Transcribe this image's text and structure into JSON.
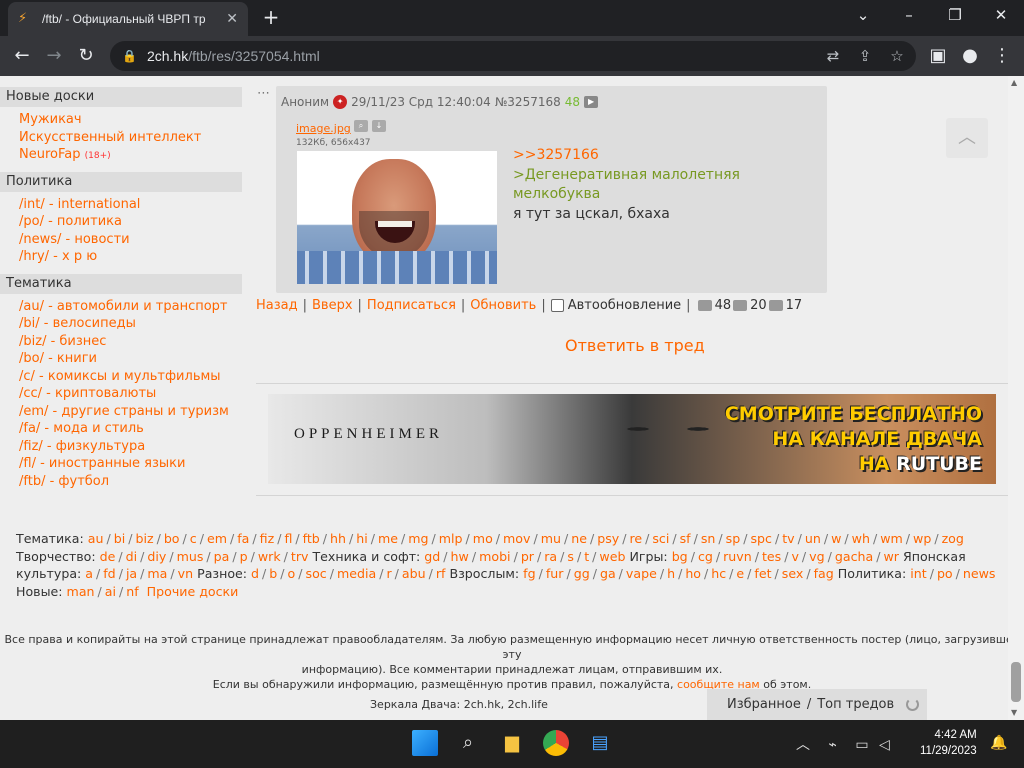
{
  "browser": {
    "tab_title": "/ftb/ - Официальный ЧВРП тр",
    "url_domain": "2ch.hk",
    "url_path": "/ftb/res/3257054.html"
  },
  "sidebar": {
    "sections": [
      {
        "title": "Новые доски",
        "items": [
          {
            "label": "Мужикач"
          },
          {
            "label": "Искусственный интеллект"
          },
          {
            "label": "NeuroFap",
            "badge": "(18+)"
          }
        ]
      },
      {
        "title": "Политика",
        "items": [
          {
            "label": "/int/ - international"
          },
          {
            "label": "/po/ - политика"
          },
          {
            "label": "/news/ - новости"
          },
          {
            "label": "/hry/ - х р ю"
          }
        ]
      },
      {
        "title": "Тематика",
        "items": [
          {
            "label": "/au/ - автомобили и транспорт"
          },
          {
            "label": "/bi/ - велосипеды"
          },
          {
            "label": "/biz/ - бизнес"
          },
          {
            "label": "/bo/ - книги"
          },
          {
            "label": "/c/ - комиксы и мультфильмы"
          },
          {
            "label": "/cc/ - криптовалюты"
          },
          {
            "label": "/em/ - другие страны и туризм"
          },
          {
            "label": "/fa/ - мода и стиль"
          },
          {
            "label": "/fiz/ - физкультура"
          },
          {
            "label": "/fl/ - иностранные языки"
          },
          {
            "label": "/ftb/ - футбол"
          }
        ]
      }
    ]
  },
  "post": {
    "author": "Аноним",
    "datetime": "29/11/23 Срд 12:40:04",
    "number": "№3257168",
    "replies": "48",
    "file_name": "image.jpg",
    "file_info": "132Кб, 656x437",
    "reflink": ">>3257166",
    "quote": ">Дегенеративная малолетняя мелкобуква",
    "text": "я тут за цскал, бхаха"
  },
  "thread_nav": {
    "back": "Назад",
    "top": "Вверх",
    "subscribe": "Подписаться",
    "refresh": "Обновить",
    "autorefresh": "Автообновление",
    "posts_count": "48",
    "images_count": "20",
    "posters_count": "17"
  },
  "reply_button": "Ответить в тред",
  "banner": {
    "film": "OPPENHEIMER",
    "line1": "СМОТРИТЕ БЕСПЛАТНО",
    "line2": "НА КАНАЛЕ ДВАЧА",
    "line3_prefix": "НА ",
    "line3_brand": "RUTUBE"
  },
  "boards": [
    {
      "category": "Тематика:",
      "links": [
        "au",
        "bi",
        "biz",
        "bo",
        "c",
        "em",
        "fa",
        "fiz",
        "fl",
        "ftb",
        "hh",
        "hi",
        "me",
        "mg",
        "mlp",
        "mo",
        "mov",
        "mu",
        "ne",
        "psy",
        "re",
        "sci",
        "sf",
        "sn",
        "sp",
        "spc",
        "tv",
        "un",
        "w",
        "wh",
        "wm",
        "wp",
        "zog"
      ]
    },
    {
      "category": "Творчество:",
      "links": [
        "de",
        "di",
        "diy",
        "mus",
        "pa",
        "p",
        "wrk",
        "trv"
      ]
    },
    {
      "category": "Техника и софт:",
      "links": [
        "gd",
        "hw",
        "mobi",
        "pr",
        "ra",
        "s",
        "t",
        "web"
      ]
    },
    {
      "category": "Игры:",
      "links": [
        "bg",
        "cg",
        "ruvn",
        "tes",
        "v",
        "vg",
        "gacha",
        "wr"
      ]
    },
    {
      "category": "Японская культура:",
      "links": [
        "a",
        "fd",
        "ja",
        "ma",
        "vn"
      ]
    },
    {
      "category": "Разное:",
      "links": [
        "d",
        "b",
        "o",
        "soc",
        "media",
        "r",
        "abu",
        "rf"
      ]
    },
    {
      "category": "Взрослым:",
      "links": [
        "fg",
        "fur",
        "gg",
        "ga",
        "vape",
        "h",
        "ho",
        "hc",
        "e",
        "fet",
        "sex",
        "fag"
      ]
    },
    {
      "category": "Политика:",
      "links": [
        "int",
        "po",
        "news"
      ]
    },
    {
      "category": "Новые:",
      "links": [
        "man",
        "ai",
        "nf"
      ]
    }
  ],
  "other_boards": "Прочие доски",
  "footer": {
    "line1": "Все права и копирайты на этой странице принадлежат правообладателям. За любую размещенную информацию несет личную ответственность постер (лицо, загрузившее эту",
    "line2": "информацию). Все комментарии принадлежат лицам, отправившим их.",
    "line3_pre": "Если вы обнаружили информацию, размещённую против правил, пожалуйста, ",
    "line3_link": "сообщите нам",
    "line3_post": " об этом.",
    "mirrors": "Зеркала Двача: 2ch.hk, 2ch.life"
  },
  "favbar": {
    "favorites": "Избранное",
    "separator": "/",
    "top_threads": "Топ тредов"
  },
  "taskbar": {
    "time": "4:42 AM",
    "date": "11/29/2023"
  },
  "colors": {
    "accent": "#ff6600",
    "quote": "#789922",
    "panel": "#dddddd",
    "background": "#eeeeee"
  }
}
